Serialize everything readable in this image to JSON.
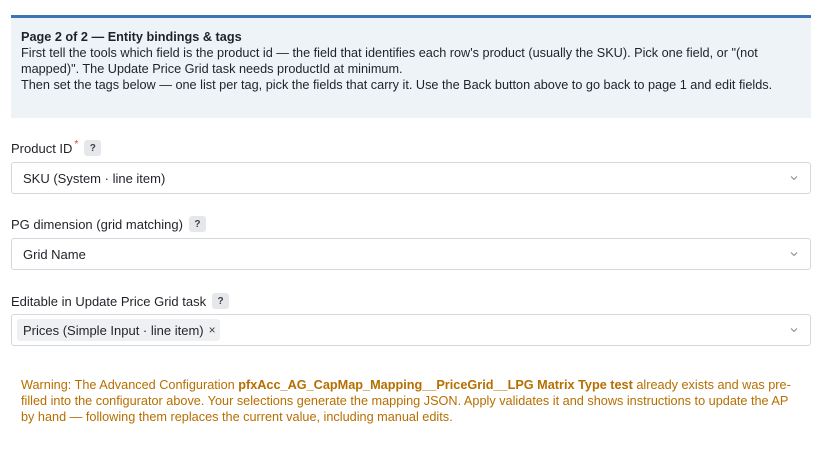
{
  "info": {
    "title": "Page 2 of 2 — Entity bindings & tags",
    "line1": "First tell the tools which field is the product id — the field that identifies each row's product (usually the SKU). Pick one field, or \"(not mapped)\". The Update Price Grid task needs productId at minimum.",
    "line2": "Then set the tags below — one list per tag, pick the fields that carry it. Use the Back button above to go back to page 1 and edit fields."
  },
  "fields": {
    "product_id": {
      "label": "Product ID",
      "required_mark": "*",
      "help": "?",
      "value": "SKU (System · line item)"
    },
    "pg_dimension": {
      "label": "PG dimension (grid matching)",
      "help": "?",
      "value": "Grid Name"
    },
    "editable": {
      "label": "Editable in Update Price Grid task",
      "help": "?",
      "tags": [
        "Prices (Simple Input · line item)"
      ],
      "tag_remove": "×"
    }
  },
  "warning": {
    "prefix": "Warning: The Advanced Configuration ",
    "config_name": "pfxAcc_AG_CapMap_Mapping__PriceGrid__LPG Matrix Type test",
    "suffix": " already exists and was pre-filled into the configurator above. Your selections generate the mapping JSON. Apply validates it and shows instructions to update the AP by hand — following them replaces the current value, including manual edits."
  },
  "colors": {
    "accent": "#3f74b4",
    "info_bg": "#eef3f8",
    "required": "#e0313b",
    "warning": "#b76e00"
  }
}
